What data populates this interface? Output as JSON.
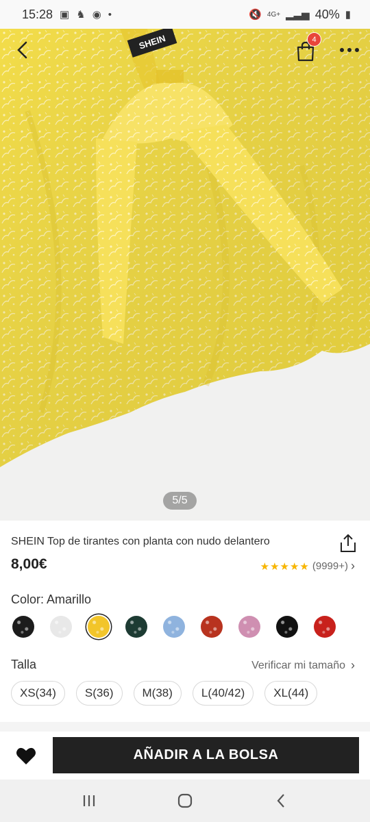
{
  "status_bar": {
    "time": "15:28",
    "battery": "40%",
    "network": "4G+"
  },
  "header": {
    "bag_count": "4",
    "icons": [
      "back-arrow-icon",
      "shopping-bag-icon",
      "more-icon"
    ]
  },
  "gallery": {
    "counter": "5/5",
    "brand_label": "SHEIN"
  },
  "product": {
    "title": "SHEIN Top de tirantes con planta con nudo delantero",
    "price": "8,00€",
    "rating_stars": "★★★★★",
    "rating_count": "(9999+)",
    "rating_value": 5
  },
  "color": {
    "label": "Color: Amarillo",
    "selected_index": 2,
    "swatches": [
      "#1c1c1c",
      "#e8e8e8",
      "#f2c52a",
      "#1d3b33",
      "#8fb3de",
      "#b8331f",
      "#cf8fb1",
      "#111111",
      "#c8211c"
    ]
  },
  "size": {
    "label": "Talla",
    "verify_label": "Verificar mi tamaño",
    "options": [
      "XS(34)",
      "S(36)",
      "M(38)",
      "L(40/42)",
      "XL(44)"
    ]
  },
  "actions": {
    "add_to_bag": "AÑADIR A LA BOLSA"
  },
  "colors": {
    "hero_yellow": "#f3dd4a",
    "button_dark": "#222222",
    "star": "#f7b500",
    "badge": "#e8463a"
  }
}
